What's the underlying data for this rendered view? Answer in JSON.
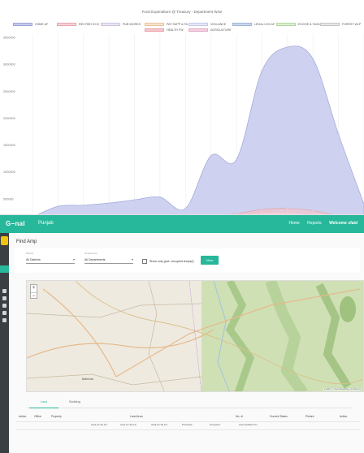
{
  "chart_data": {
    "type": "area",
    "title": "Fund Expenditure @ Treasury - Department Wise",
    "categories": [
      "",
      "",
      "",
      "",
      "",
      "",
      "",
      "",
      "",
      "",
      "",
      "",
      "",
      ""
    ],
    "ylim": [
      0,
      3500000
    ],
    "yticks": [
      "500000",
      "1000000",
      "1500000",
      "2000000",
      "2500000",
      "3000000",
      "3500000"
    ],
    "grid": "vertical",
    "legend_position": "top",
    "series": [
      {
        "name": "HOME AF",
        "color": "#c5c9ec",
        "stroke": "#9ea5d8",
        "values": [
          160000,
          360000,
          380000,
          420000,
          480000,
          530000,
          320000,
          1300000,
          1230000,
          2880000,
          3320000,
          3100000,
          1700000,
          400000
        ]
      },
      {
        "name": "REV REH DI M",
        "color": "#f6d0d5",
        "stroke": "#e8a6b0",
        "values": [
          10000,
          20000,
          40000,
          50000,
          60000,
          80000,
          50000,
          120000,
          180000,
          260000,
          240000,
          200000,
          120000,
          60000
        ]
      },
      {
        "name": "PUB WORKS",
        "color": "#ece5f2",
        "stroke": "#cfc2e0",
        "values": [
          30000,
          60000,
          90000,
          120000,
          140000,
          150000,
          100000,
          160000,
          200000,
          240000,
          260000,
          210000,
          140000,
          80000
        ]
      },
      {
        "name": "PAT SUPP & FA",
        "color": "#f8e3cf",
        "stroke": "#eac39e",
        "values": [
          5000,
          10000,
          15000,
          20000,
          30000,
          30000,
          20000,
          40000,
          60000,
          80000,
          70000,
          60000,
          40000,
          20000
        ]
      },
      {
        "name": "VIGILANCE",
        "color": "#e5e8f6",
        "stroke": "#c3c8e6",
        "values": [
          5000,
          8000,
          10000,
          12000,
          14000,
          16000,
          10000,
          20000,
          25000,
          30000,
          28000,
          22000,
          16000,
          10000
        ]
      },
      {
        "name": "LEGAL LEG AF",
        "color": "#c9d7ec",
        "stroke": "#9fb4d8",
        "values": [
          4000,
          6000,
          8000,
          10000,
          12000,
          14000,
          9000,
          18000,
          22000,
          28000,
          26000,
          20000,
          14000,
          8000
        ]
      },
      {
        "name": "EXCISE & TAXATION",
        "color": "#dcefd4",
        "stroke": "#b2d6a3",
        "values": [
          6000,
          9000,
          12000,
          15000,
          18000,
          20000,
          14000,
          24000,
          30000,
          36000,
          34000,
          28000,
          20000,
          12000
        ]
      },
      {
        "name": "FOREST WLP",
        "color": "#e6e6e6",
        "stroke": "#c4c4c4",
        "values": [
          3000,
          5000,
          7000,
          9000,
          11000,
          12000,
          8000,
          15000,
          18000,
          22000,
          20000,
          16000,
          11000,
          6000
        ]
      },
      {
        "name": "HEALTH FW",
        "color": "#f6c7cc",
        "stroke": "#e7a0a8",
        "values": [
          20000,
          40000,
          70000,
          100000,
          130000,
          160000,
          120000,
          180000,
          220000,
          300000,
          320000,
          280000,
          180000,
          90000
        ]
      },
      {
        "name": "AGRICULTURE",
        "color": "#f4d3e3",
        "stroke": "#e3a9c5",
        "values": [
          8000,
          15000,
          22000,
          30000,
          38000,
          45000,
          30000,
          50000,
          65000,
          80000,
          76000,
          60000,
          42000,
          22000
        ]
      }
    ]
  },
  "app": {
    "brand": "G−nal",
    "state": "Punjab",
    "nav": [
      "Home",
      "Reports"
    ],
    "user": "Welcome sfaid",
    "page_title": "Find Amp",
    "filters": [
      {
        "label": "District",
        "value": "All Districts"
      },
      {
        "label": "Department",
        "value": "All Departments"
      }
    ],
    "checkbox_label": "Show only govt. occupied shops(l)",
    "view_button": "View",
    "map": {
      "attribution": "Leaflet | © OpenStreetMap contributors",
      "cities": [
        "Bathinda"
      ]
    },
    "tabs": [
      "Land",
      "Building"
    ],
    "table": {
      "headers": [
        "Action",
        "Office",
        "Property",
        "Land Area",
        "No. of",
        "Current Status",
        "Picture",
        "Action"
      ],
      "subheaders": [
        "Area (In Sq Ft)",
        "Area (In Sq Ft)",
        "Total (In Sq Ft)",
        "Purchase",
        "Occupied",
        "Last Updated On"
      ]
    }
  }
}
